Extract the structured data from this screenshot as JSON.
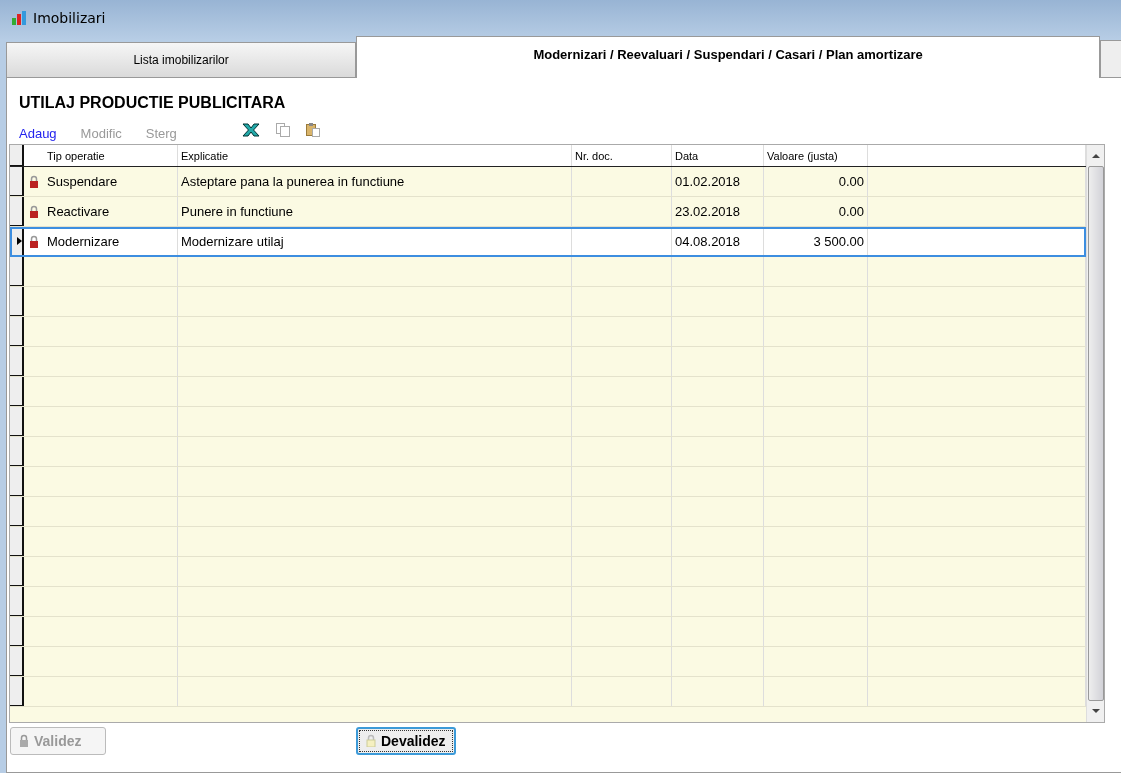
{
  "window": {
    "title": "Imobilizari"
  },
  "tabs": [
    {
      "label": "Lista imobilizarilor",
      "selected": false
    },
    {
      "label": "Modernizari / Reevaluari / Suspendari / Casari / Plan amortizare",
      "selected": true
    }
  ],
  "heading": "UTILAJ PRODUCTIE PUBLICITARA",
  "toolbar": [
    {
      "label": "Adaug",
      "disabled": false
    },
    {
      "label": "Modific",
      "disabled": true
    },
    {
      "label": "Sterg",
      "disabled": true
    }
  ],
  "table": {
    "columns": [
      "Tip operatie",
      "Explicatie",
      "Nr. doc.",
      "Data",
      "Valoare (justa)"
    ],
    "rows": [
      {
        "cells": [
          "Suspendare",
          "Asteptare pana la punerea in functiune",
          "",
          "01.02.2018",
          "0.00"
        ],
        "selected": false
      },
      {
        "cells": [
          "Reactivare",
          "Punere in functiune",
          "",
          "23.02.2018",
          "0.00"
        ],
        "selected": false
      },
      {
        "cells": [
          "Modernizare",
          "Modernizare utilaj",
          "",
          "04.08.2018",
          "3 500.00"
        ],
        "selected": true
      }
    ]
  },
  "buttons": [
    {
      "label": "Validez",
      "disabled": true
    },
    {
      "label": "Devalidez",
      "disabled": false
    }
  ]
}
